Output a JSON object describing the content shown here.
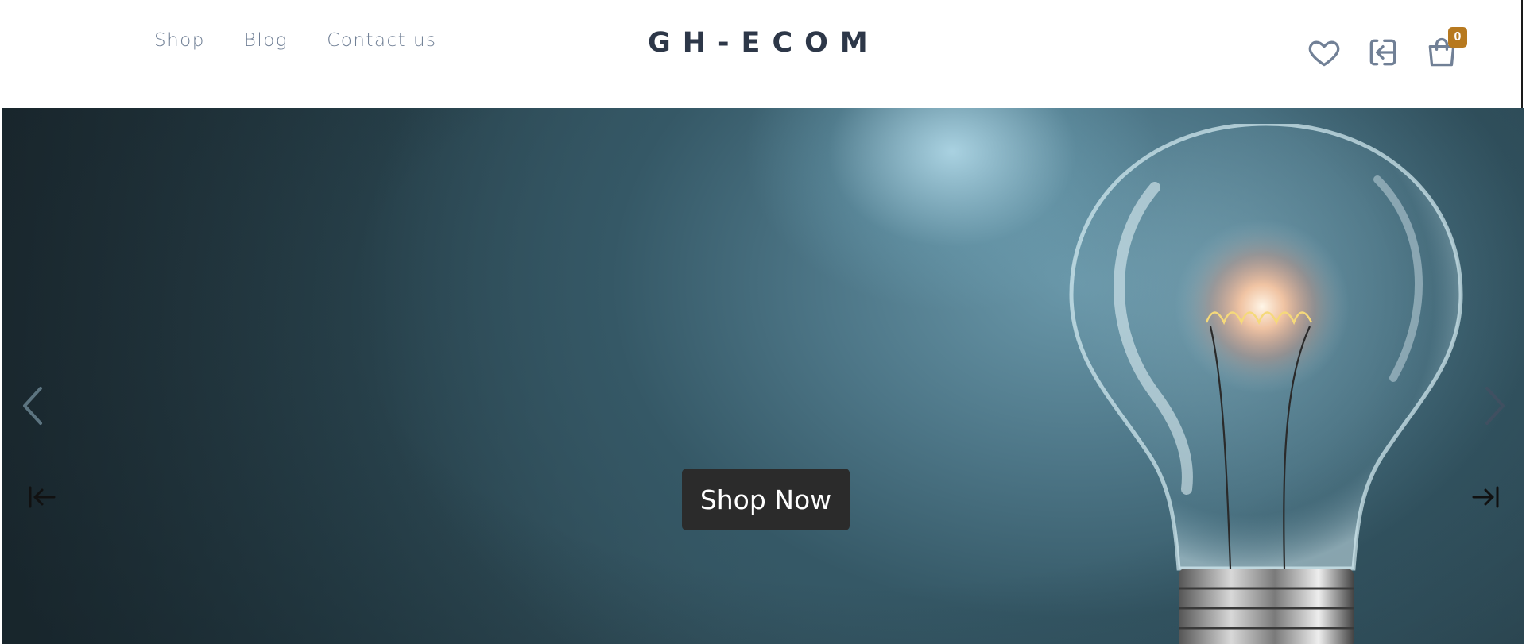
{
  "nav": {
    "links": [
      "Shop",
      "Blog",
      "Contact us"
    ]
  },
  "brand": {
    "logo_text": "GH-ECOM"
  },
  "header_icons": {
    "wishlist": "heart-icon",
    "login": "sign-in-icon",
    "cart": "shopping-bag-icon",
    "cart_count": "0"
  },
  "hero": {
    "cta_label": "Shop Now",
    "image": "light-bulb-photo",
    "prev_icon": "chevron-left-icon",
    "next_icon": "chevron-right-icon",
    "first_icon": "arrow-to-start-icon",
    "last_icon": "arrow-to-end-icon"
  },
  "colors": {
    "text_muted": "#718096",
    "text_dark": "#2d3748",
    "badge": "#b7791f",
    "button_bg": "#2b2b2b"
  }
}
